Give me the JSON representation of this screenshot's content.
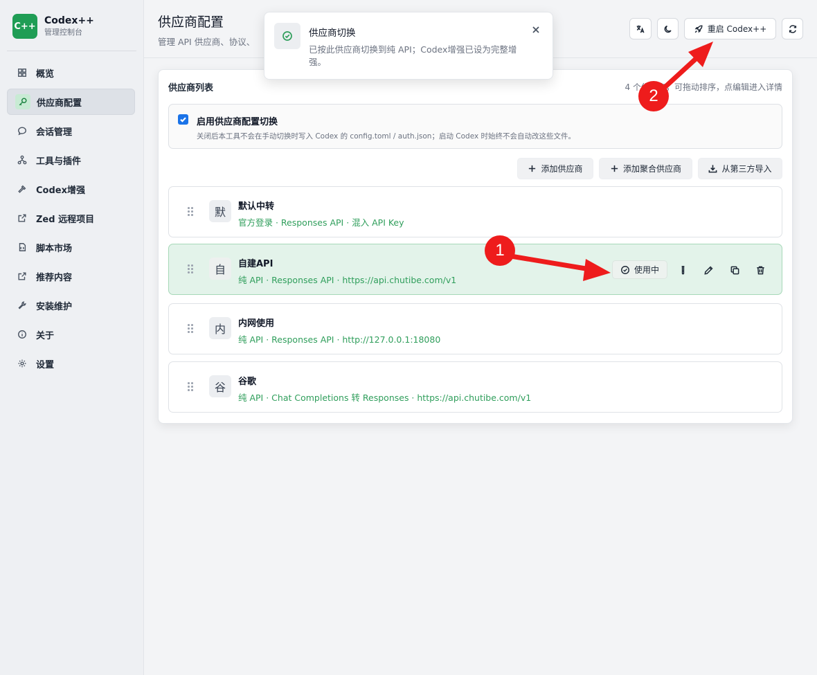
{
  "brand": {
    "logo": "C++",
    "name": "Codex++",
    "subtitle": "管理控制台",
    "logo_color": "#1f9d55"
  },
  "sidebar": {
    "items": [
      {
        "label": "概览",
        "icon": "grid-icon",
        "active": false
      },
      {
        "label": "供应商配置",
        "icon": "key-icon",
        "active": true
      },
      {
        "label": "会话管理",
        "icon": "chat-bubble-icon",
        "active": false
      },
      {
        "label": "工具与插件",
        "icon": "network-icon",
        "active": false
      },
      {
        "label": "Codex增强",
        "icon": "hammer-icon",
        "active": false
      },
      {
        "label": "Zed 远程项目",
        "icon": "external-link-icon",
        "active": false
      },
      {
        "label": "脚本市场",
        "icon": "script-file-icon",
        "active": false
      },
      {
        "label": "推荐内容",
        "icon": "external-link-icon",
        "active": false
      },
      {
        "label": "安装维护",
        "icon": "wrench-icon",
        "active": false
      },
      {
        "label": "关于",
        "icon": "info-icon",
        "active": false
      },
      {
        "label": "设置",
        "icon": "gear-icon",
        "active": false
      }
    ]
  },
  "header": {
    "title": "供应商配置",
    "subtitle": "管理 API 供应商、协议、",
    "restart_label": "重启 Codex++"
  },
  "toast": {
    "title": "供应商切换",
    "message": "已按此供应商切换到纯 API；Codex增强已设为完整增强。"
  },
  "providers_card": {
    "title": "供应商列表",
    "hint": "4 个供应商，可拖动排序，点编辑进入详情",
    "switch": {
      "checked": true,
      "title": "启用供应商配置切换",
      "description": "关闭后本工具不会在手动切换时写入 Codex 的 config.toml / auth.json；启动 Codex 时始终不会自动改这些文件。"
    },
    "actions": {
      "add_provider": "添加供应商",
      "add_aggregate": "添加聚合供应商",
      "import_third_party": "从第三方导入"
    },
    "providers": [
      {
        "avatar": "默",
        "name": "默认中转",
        "meta": "官方登录 · Responses API · 混入 API Key",
        "active": false
      },
      {
        "avatar": "自",
        "name": "自建API",
        "meta": "纯 API · Responses API · https://api.chutibe.com/v1",
        "active": true,
        "status": "使用中"
      },
      {
        "avatar": "内",
        "name": "内网使用",
        "meta": "纯 API · Responses API · http://127.0.0.1:18080",
        "active": false
      },
      {
        "avatar": "谷",
        "name": "谷歌",
        "meta": "纯 API · Chat Completions 转 Responses · https://api.chutibe.com/v1",
        "active": false
      }
    ]
  },
  "annotations": [
    {
      "label": "1",
      "color": "#ee1c1c"
    },
    {
      "label": "2",
      "color": "#ee1c1c"
    }
  ]
}
